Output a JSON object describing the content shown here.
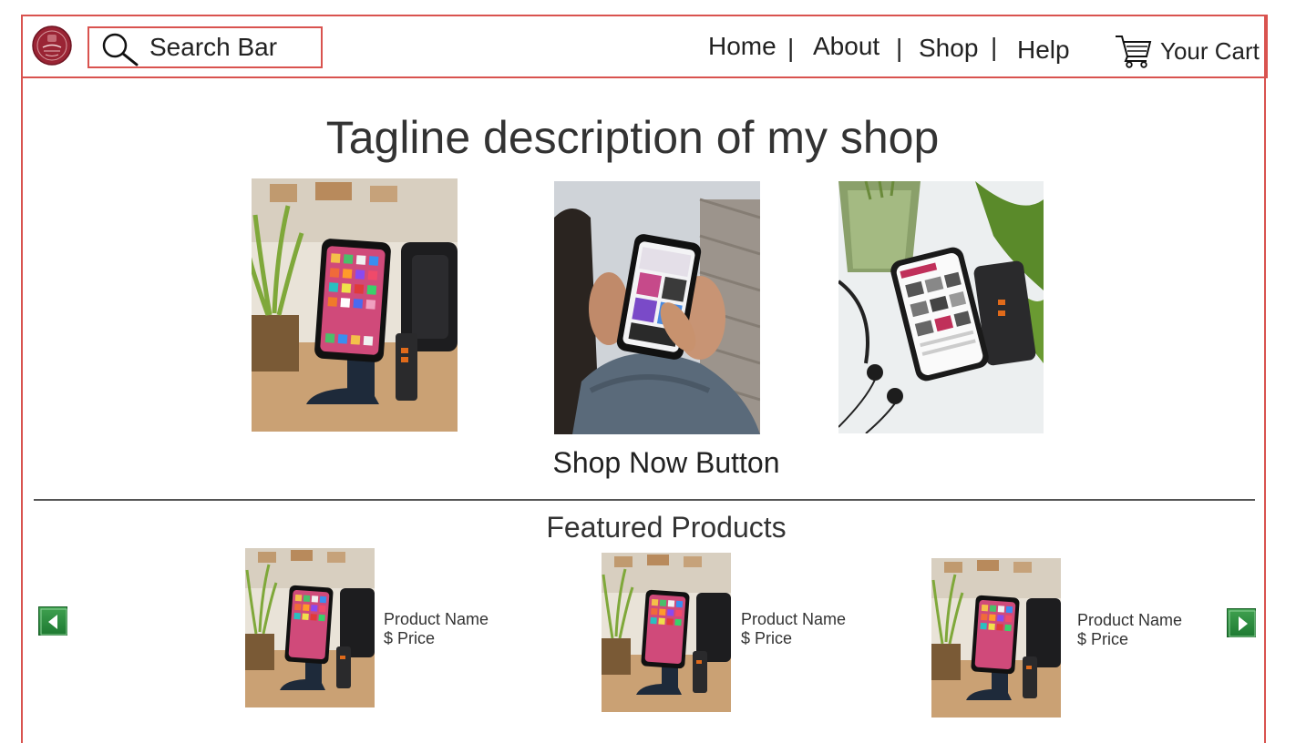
{
  "header": {
    "search": {
      "label": "Search Bar"
    },
    "nav": [
      {
        "label": "Home"
      },
      {
        "label": "About"
      },
      {
        "label": "Shop"
      },
      {
        "label": "Help"
      }
    ],
    "nav_separator": "|",
    "cart_label": "Your Cart"
  },
  "hero": {
    "tagline": "Tagline description of my shop",
    "shop_now_label": "Shop Now Button"
  },
  "featured": {
    "title": "Featured Products",
    "products": [
      {
        "name": "Product Name",
        "price": "$ Price"
      },
      {
        "name": "Product Name",
        "price": "$ Price"
      },
      {
        "name": "Product Name",
        "price": "$ Price"
      }
    ]
  },
  "colors": {
    "frame_border": "#d9534f",
    "arrow_green": "#2e8b3e",
    "logo_maroon": "#8b1e2e"
  }
}
